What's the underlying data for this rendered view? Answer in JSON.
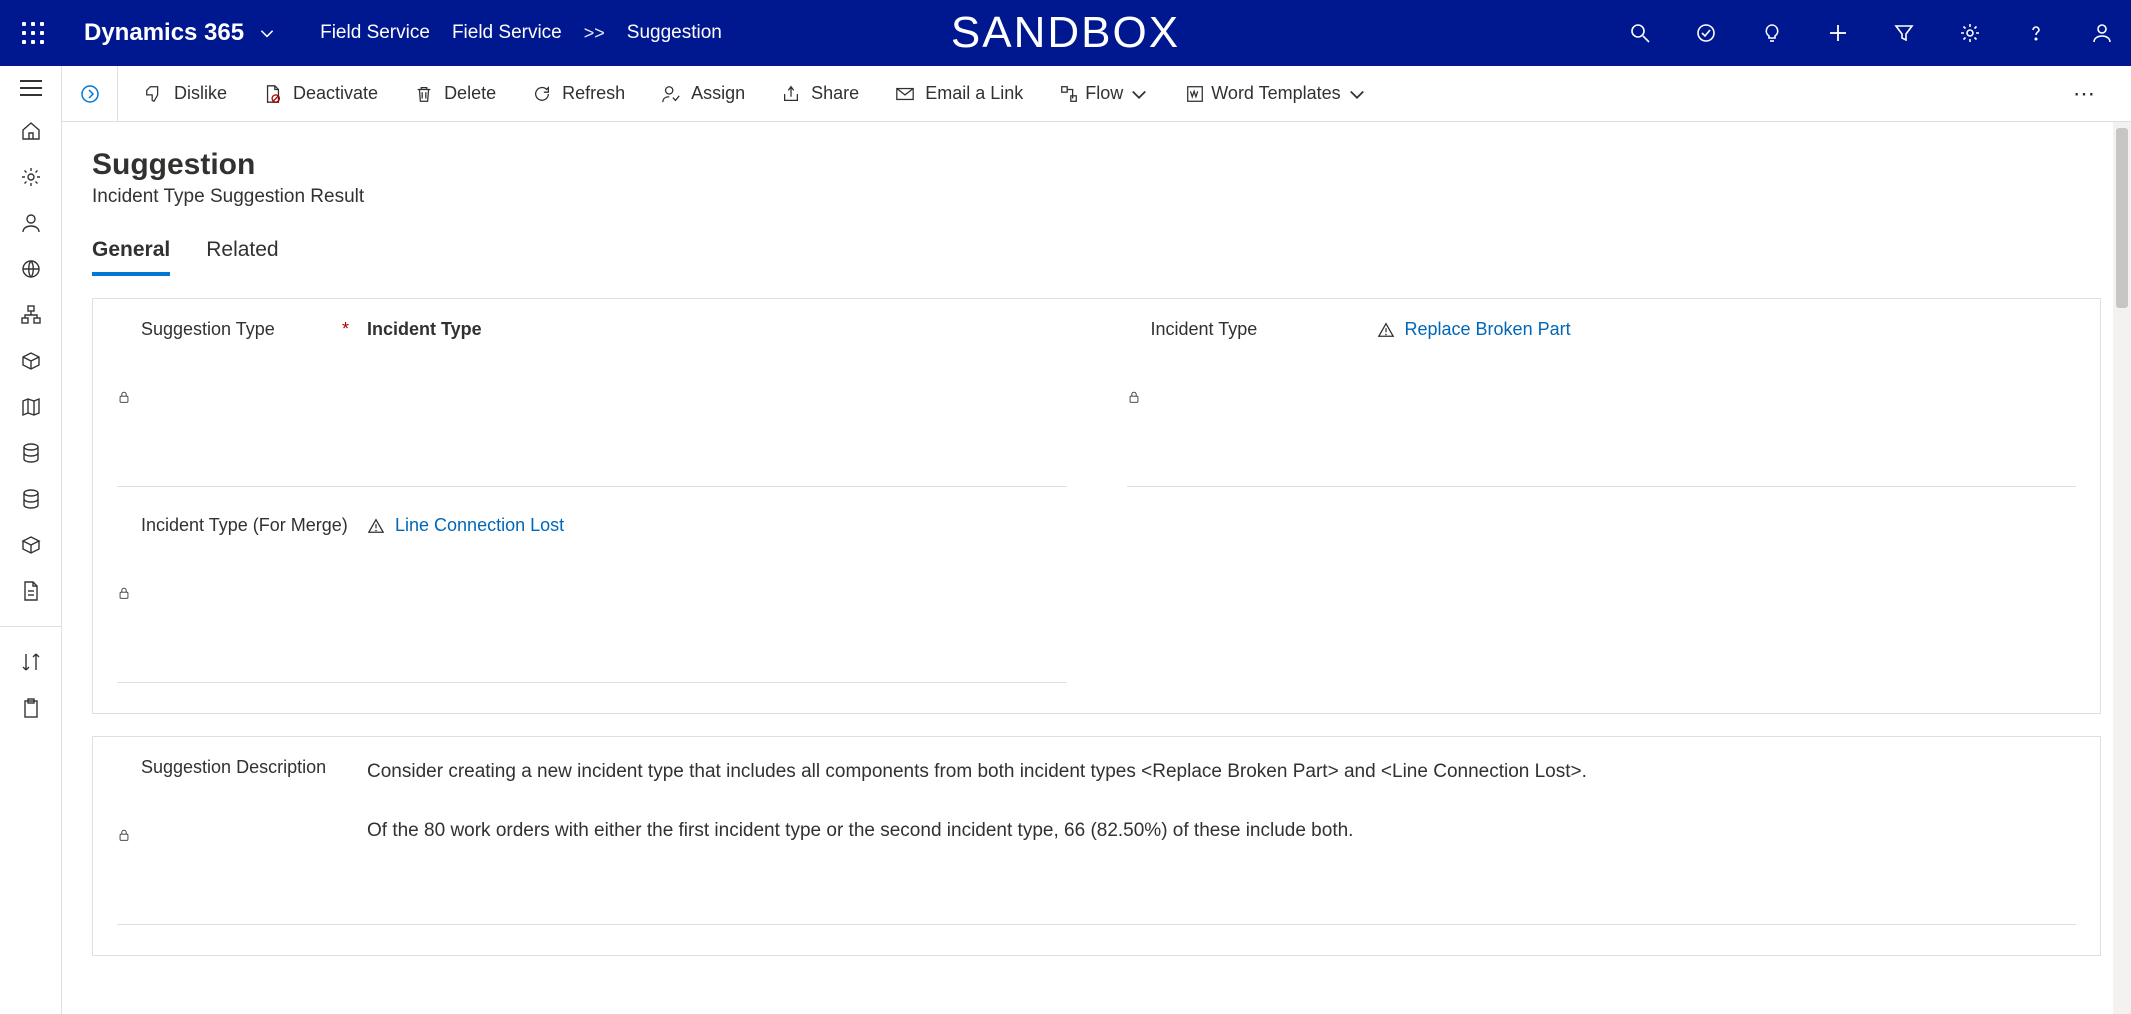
{
  "header": {
    "app_name": "Dynamics 365",
    "breadcrumb": [
      "Field Service",
      "Field Service",
      "Suggestion"
    ],
    "environment_label": "SANDBOX"
  },
  "commands": {
    "dislike": "Dislike",
    "deactivate": "Deactivate",
    "delete": "Delete",
    "refresh": "Refresh",
    "assign": "Assign",
    "share": "Share",
    "email_link": "Email a Link",
    "flow": "Flow",
    "word_templates": "Word Templates"
  },
  "page": {
    "title": "Suggestion",
    "subtitle": "Incident Type Suggestion Result",
    "tabs": [
      "General",
      "Related"
    ],
    "active_tab": "General"
  },
  "fields": {
    "suggestion_type": {
      "label": "Suggestion Type",
      "value": "Incident Type",
      "required": true
    },
    "incident_type": {
      "label": "Incident Type",
      "value": "Replace Broken Part"
    },
    "incident_type_merge": {
      "label": "Incident Type (For Merge)",
      "value": "Line Connection Lost"
    },
    "suggestion_description": {
      "label": "Suggestion Description",
      "value": "Consider creating a new incident type that includes all components from both incident types <Replace Broken Part> and <Line Connection Lost>.\n\nOf the 80 work orders with either the first incident type or the second incident type, 66 (82.50%) of these include both."
    }
  }
}
